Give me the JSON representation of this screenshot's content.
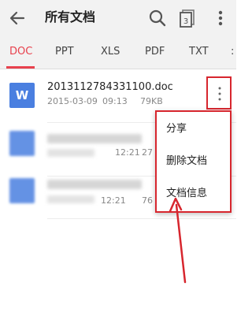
{
  "header": {
    "title": "所有文档",
    "icons": [
      "back-arrow-icon",
      "search-icon",
      "tabs-icon",
      "overflow-menu-icon"
    ],
    "tab_count": "3"
  },
  "tabs": [
    {
      "label": "DOC",
      "active": true
    },
    {
      "label": "PPT",
      "active": false
    },
    {
      "label": "XLS",
      "active": false
    },
    {
      "label": "PDF",
      "active": false
    },
    {
      "label": "TXT",
      "active": false
    }
  ],
  "files": [
    {
      "name": "2013112784331100.doc",
      "date": "2015-03-09",
      "time": "09:13",
      "size": "79KB",
      "icon": "word-doc-icon"
    },
    {
      "name": "",
      "date": "",
      "time": "12:21",
      "size": "27",
      "icon": "doc-icon"
    },
    {
      "name": "",
      "date": "",
      "time": "12:21",
      "size": "76",
      "icon": "doc-icon"
    }
  ],
  "context_menu": {
    "items": [
      "分享",
      "删除文档",
      "文档信息"
    ]
  },
  "colors": {
    "accent": "#e8414d",
    "annotation": "#d7262e",
    "file_icon": "#4a7fe0"
  }
}
